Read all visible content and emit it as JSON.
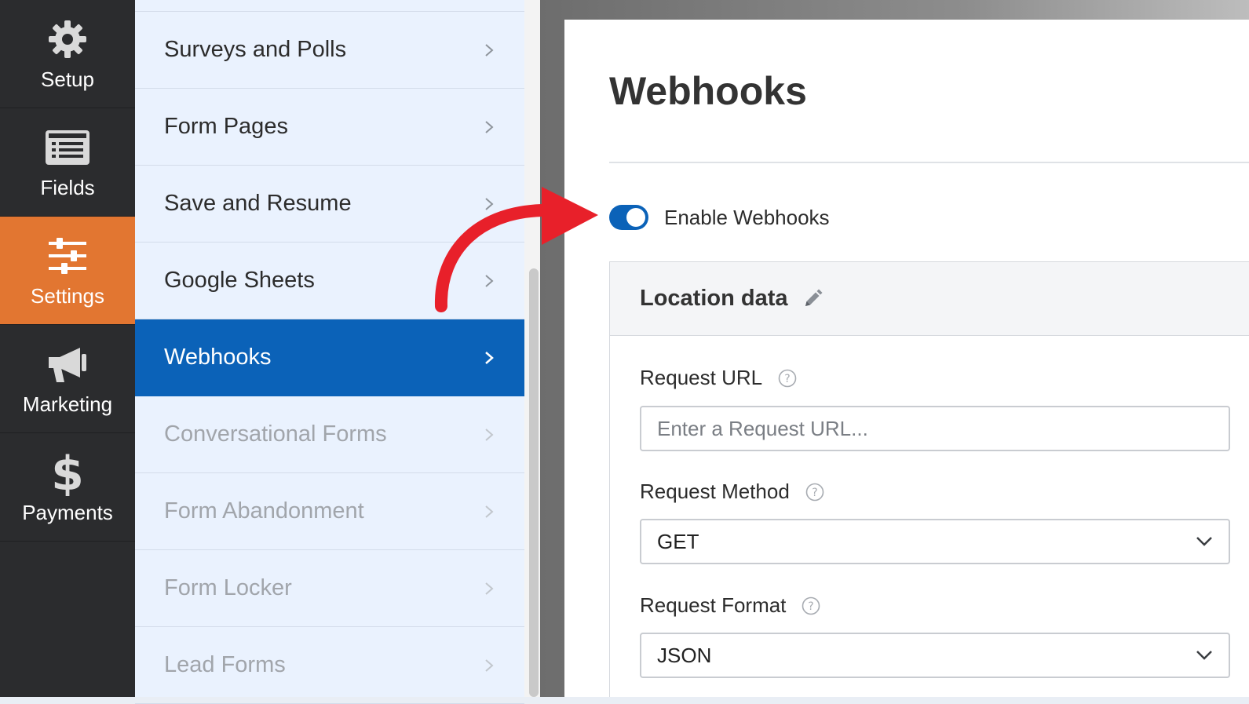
{
  "rail": {
    "items": [
      {
        "label": "Setup",
        "icon": "gear-icon"
      },
      {
        "label": "Fields",
        "icon": "list-icon"
      },
      {
        "label": "Settings",
        "icon": "sliders-icon",
        "active": true
      },
      {
        "label": "Marketing",
        "icon": "megaphone-icon"
      },
      {
        "label": "Payments",
        "icon": "dollar-icon"
      }
    ]
  },
  "submenu": {
    "items": [
      {
        "label": "Surveys and Polls"
      },
      {
        "label": "Form Pages"
      },
      {
        "label": "Save and Resume"
      },
      {
        "label": "Google Sheets"
      },
      {
        "label": "Webhooks",
        "active": true
      },
      {
        "label": "Conversational Forms",
        "disabled": true
      },
      {
        "label": "Form Abandonment",
        "disabled": true
      },
      {
        "label": "Form Locker",
        "disabled": true
      },
      {
        "label": "Lead Forms",
        "disabled": true
      }
    ]
  },
  "panel": {
    "title": "Webhooks",
    "toggle": {
      "label": "Enable Webhooks",
      "on": true
    },
    "location": {
      "title": "Location data",
      "request_url": {
        "label": "Request URL",
        "placeholder": "Enter a Request URL...",
        "value": ""
      },
      "request_method": {
        "label": "Request Method",
        "value": "GET"
      },
      "request_format": {
        "label": "Request Format",
        "value": "JSON"
      }
    }
  },
  "colors": {
    "accent": "#0b62b8",
    "active_rail": "#e27631",
    "rail_bg": "#2b2c2e",
    "annotation_arrow": "#e8202a"
  }
}
